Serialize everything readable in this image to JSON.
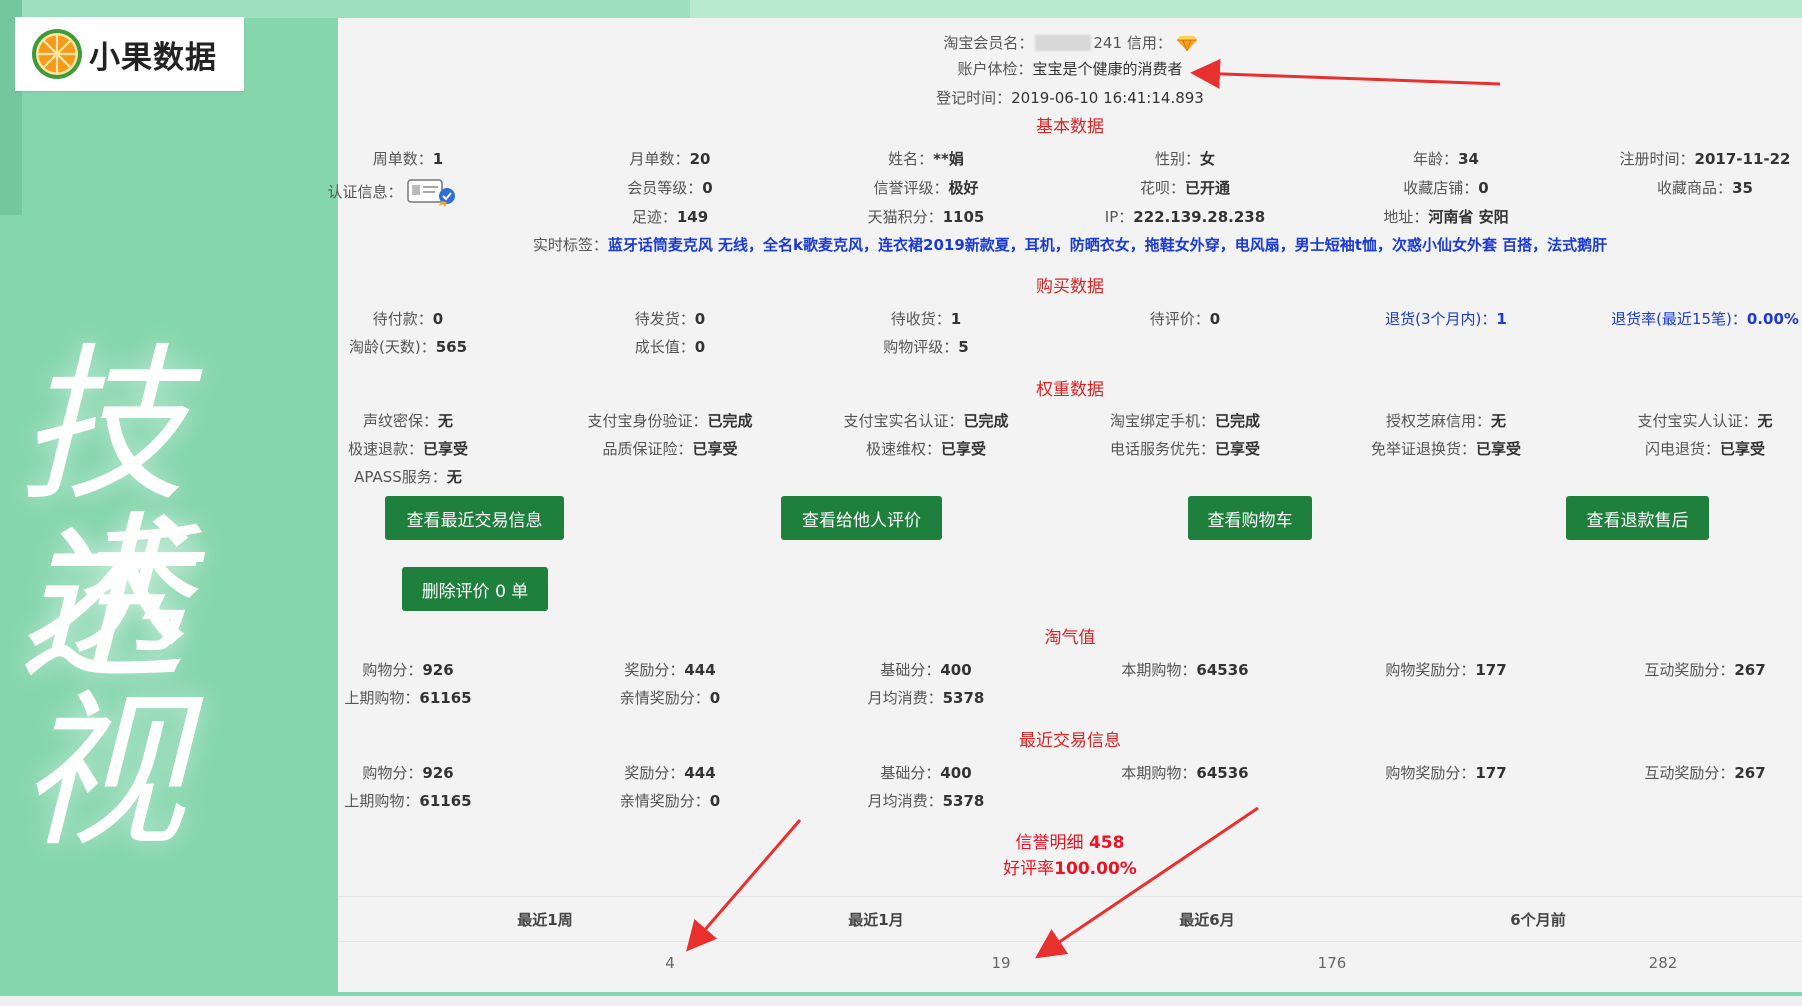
{
  "brand": {
    "logo_text": "小果数据"
  },
  "slogan": {
    "line1": "技术",
    "line2": "透视"
  },
  "profile": {
    "name_label": "淘宝会员名：",
    "name_suffix": "241",
    "credit_label": "信用：",
    "check_label": "账户体检：",
    "check_value": "宝宝是个健康的消费者",
    "reg_label": "登记时间：",
    "reg_value": "2019-06-10 16:41:14.893"
  },
  "basic": {
    "title": "基本数据",
    "rows": [
      [
        {
          "label": "周单数：",
          "value": "1"
        },
        {
          "label": "月单数：",
          "value": "20"
        },
        {
          "label": "姓名：",
          "value": "**娟"
        },
        {
          "label": "性别：",
          "value": "女"
        },
        {
          "label": "年龄：",
          "value": "34"
        },
        {
          "label": "注册时间：",
          "value": "2017-11-22"
        }
      ],
      [
        {
          "label": "认证信息：",
          "value": ""
        },
        {
          "label": "会员等级：",
          "value": "0"
        },
        {
          "label": "信誉评级：",
          "value": "极好"
        },
        {
          "label": "花呗：",
          "value": "已开通"
        },
        {
          "label": "收藏店铺：",
          "value": "0"
        },
        {
          "label": "收藏商品：",
          "value": "35"
        }
      ],
      [
        {
          "label": "足迹：",
          "value": "149"
        },
        {
          "label": "天猫积分：",
          "value": "1105"
        },
        {
          "label": "IP：",
          "value": "222.139.28.238"
        },
        {
          "label": "地址：",
          "value": "河南省 安阳"
        }
      ]
    ],
    "tags_label": "实时标签：",
    "tags_value": "蓝牙话筒麦克风 无线，全名k歌麦克风，连衣裙2019新款夏，耳机，防晒衣女，拖鞋女外穿，电风扇，男士短袖t恤，次惑小仙女外套 百搭，法式鹅肝"
  },
  "purchase": {
    "title": "购买数据",
    "rows": [
      [
        {
          "label": "待付款：",
          "value": "0"
        },
        {
          "label": "待发货：",
          "value": "0"
        },
        {
          "label": "待收货：",
          "value": "1"
        },
        {
          "label": "待评价：",
          "value": "0"
        },
        {
          "label": "退货(3个月内)：",
          "value": "1"
        },
        {
          "label": "退货率(最近15笔)：",
          "value": "0.00%"
        }
      ],
      [
        {
          "label": "淘龄(天数)：",
          "value": "565"
        },
        {
          "label": "成长值：",
          "value": "0"
        },
        {
          "label": "购物评级：",
          "value": "5"
        }
      ]
    ]
  },
  "weight": {
    "title": "权重数据",
    "rows": [
      [
        {
          "label": "声纹密保：",
          "value": "无"
        },
        {
          "label": "支付宝身份验证：",
          "value": "已完成"
        },
        {
          "label": "支付宝实名认证：",
          "value": "已完成"
        },
        {
          "label": "淘宝绑定手机：",
          "value": "已完成"
        },
        {
          "label": "授权芝麻信用：",
          "value": "无"
        },
        {
          "label": "支付宝实人认证：",
          "value": "无"
        }
      ],
      [
        {
          "label": "极速退款：",
          "value": "已享受"
        },
        {
          "label": "品质保证险：",
          "value": "已享受"
        },
        {
          "label": "极速维权：",
          "value": "已享受"
        },
        {
          "label": "电话服务优先：",
          "value": "已享受"
        },
        {
          "label": "免举证退换货：",
          "value": "已享受"
        },
        {
          "label": "闪电退货：",
          "value": "已享受"
        }
      ],
      [
        {
          "label": "APASS服务：",
          "value": "无"
        }
      ]
    ]
  },
  "buttons": {
    "recent_trade": "查看最近交易信息",
    "reviews_to_others": "查看给他人评价",
    "cart": "查看购物车",
    "refund": "查看退款售后",
    "delete_reviews": "删除评价 0 单"
  },
  "taoqi": {
    "title": "淘气值",
    "rows": [
      [
        {
          "label": "购物分：",
          "value": "926"
        },
        {
          "label": "奖励分：",
          "value": "444"
        },
        {
          "label": "基础分：",
          "value": "400"
        },
        {
          "label": "本期购物：",
          "value": "64536"
        },
        {
          "label": "购物奖励分：",
          "value": "177"
        },
        {
          "label": "互动奖励分：",
          "value": "267"
        }
      ],
      [
        {
          "label": "上期购物：",
          "value": "61165"
        },
        {
          "label": "亲情奖励分：",
          "value": "0"
        },
        {
          "label": "月均消费：",
          "value": "5378"
        }
      ]
    ]
  },
  "recent": {
    "title": "最近交易信息",
    "rows": [
      [
        {
          "label": "购物分：",
          "value": "926"
        },
        {
          "label": "奖励分：",
          "value": "444"
        },
        {
          "label": "基础分：",
          "value": "400"
        },
        {
          "label": "本期购物：",
          "value": "64536"
        },
        {
          "label": "购物奖励分：",
          "value": "177"
        },
        {
          "label": "互动奖励分：",
          "value": "267"
        }
      ],
      [
        {
          "label": "上期购物：",
          "value": "61165"
        },
        {
          "label": "亲情奖励分：",
          "value": "0"
        },
        {
          "label": "月均消费：",
          "value": "5378"
        }
      ]
    ]
  },
  "credit_detail": {
    "label": "信誉明细 ",
    "value": "458",
    "rate_label": "好评率",
    "rate_value": "100.00%"
  },
  "credit_table": {
    "headers": [
      "最近1周",
      "最近1月",
      "最近6月",
      "6个月前"
    ],
    "values": [
      "4",
      "19",
      "176",
      "282"
    ]
  },
  "colors": {
    "accent_red": "#e12222",
    "button_green": "#1f7f3c",
    "link_blue": "#1a39d6",
    "background_green": "#86d6ad"
  },
  "icons": {
    "credit": "diamond-icon",
    "cert": "id-card-icon"
  }
}
